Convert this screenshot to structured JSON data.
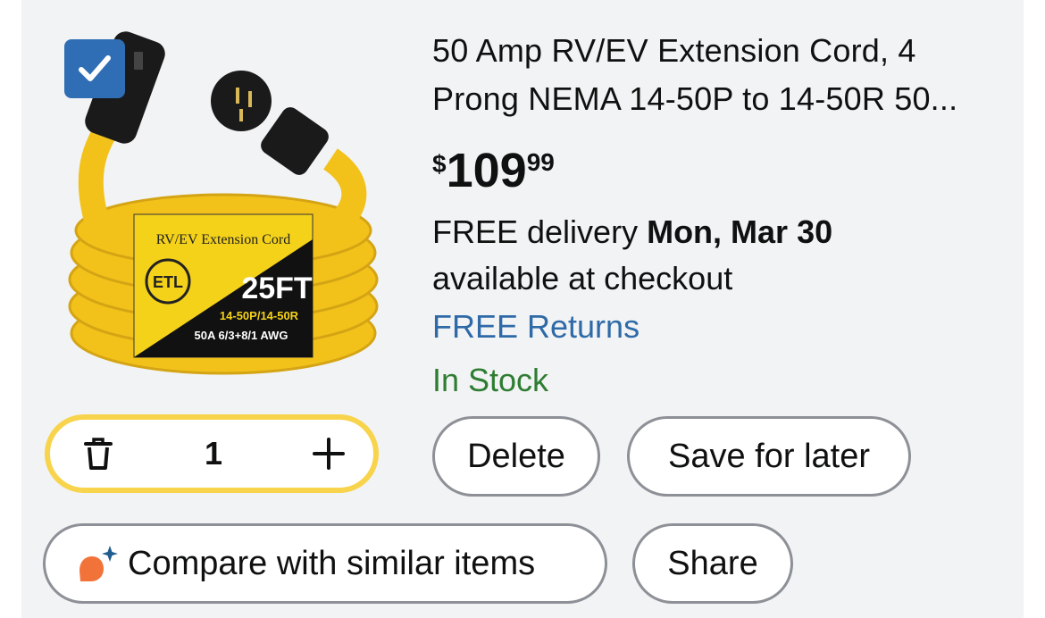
{
  "product": {
    "title": "50 Amp RV/EV Extension Cord, 4 Prong NEMA 14-50P to 14-50R 50...",
    "price": {
      "symbol": "$",
      "whole": "109",
      "fraction": "99"
    },
    "delivery": {
      "prefix": "FREE delivery ",
      "date": "Mon, Mar 30",
      "suffix": "available at checkout"
    },
    "returns": "FREE Returns",
    "stock": "In Stock",
    "selected": true,
    "image_label": {
      "line1": "RV/EV Extension Cord",
      "length": "25FT",
      "spec1": "14-50P/14-50R",
      "spec2": "50A 6/3+8/1 AWG",
      "badge": "ETL"
    }
  },
  "quantity": {
    "value": "1"
  },
  "actions": {
    "delete_label": "Delete",
    "save_label": "Save for later",
    "compare_label": "Compare with similar items",
    "share_label": "Share"
  },
  "colors": {
    "checkbox": "#2f6db5",
    "returns_link": "#2e6aa8",
    "in_stock": "#2e7d32",
    "quantity_border": "#f7d44c",
    "cord_yellow": "#f2c21b"
  },
  "icons": [
    "checkmark-icon",
    "trash-icon",
    "plus-icon",
    "compare-sparkle-icon"
  ]
}
